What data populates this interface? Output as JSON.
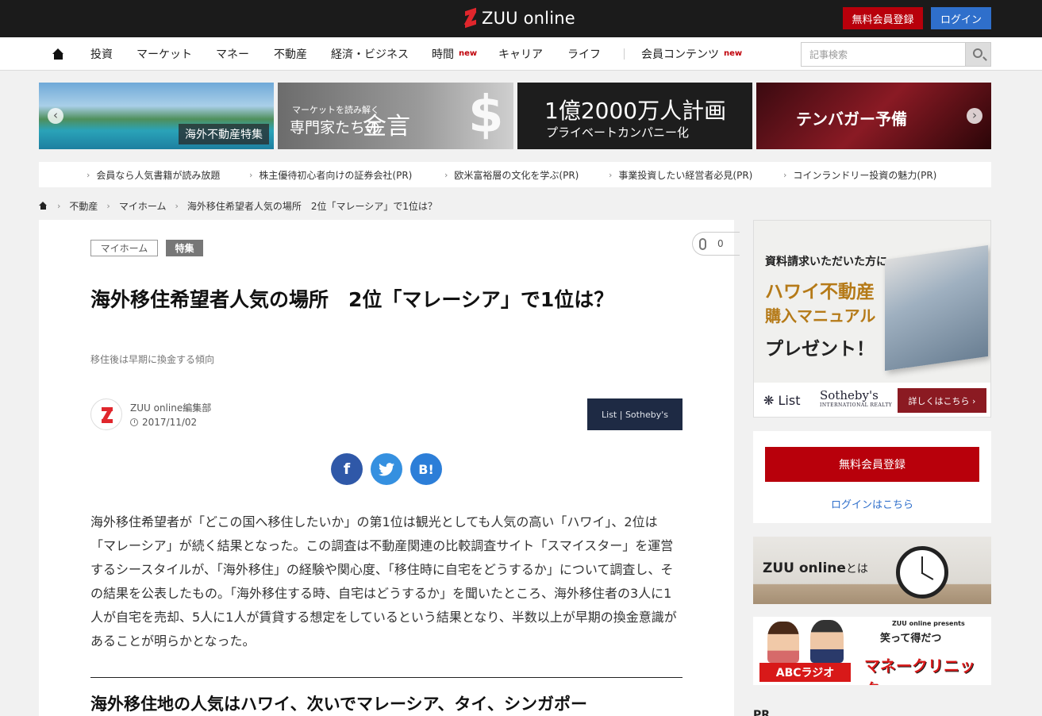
{
  "header": {
    "logo_text": "ZUU online",
    "register_label": "無料会員登録",
    "login_label": "ログイン"
  },
  "nav": {
    "items": [
      {
        "label": "投資"
      },
      {
        "label": "マーケット"
      },
      {
        "label": "マネー"
      },
      {
        "label": "不動産"
      },
      {
        "label": "経済・ビジネス"
      },
      {
        "label": "時間",
        "badge": "new"
      },
      {
        "label": "キャリア"
      },
      {
        "label": "ライフ"
      },
      {
        "label": "会員コンテンツ",
        "badge": "new"
      }
    ],
    "search_placeholder": "記事検索"
  },
  "banners": [
    {
      "text": "海外不動産特集"
    },
    {
      "text1": "マーケットを読み解く",
      "text2": "専門家たちの",
      "text3": "金言",
      "symbol": "$"
    },
    {
      "text1": "1億2000万人計画",
      "text2": "プライベートカンパニー化"
    },
    {
      "text": "テンバガー予備"
    }
  ],
  "banner_prev": "‹",
  "banner_next": "›",
  "pr_links": [
    "会員なら人気書籍が読み放題",
    "株主優待初心者向けの証券会社(PR)",
    "欧米富裕層の文化を学ぶ(PR)",
    "事業投資したい経営者必見(PR)",
    "コインランドリー投資の魅力(PR)"
  ],
  "breadcrumb": {
    "items": [
      "不動産",
      "マイホーム",
      "海外移住希望者人気の場所　2位「マレーシア」で1位は？"
    ]
  },
  "article": {
    "tags": [
      "マイホーム",
      "特集"
    ],
    "clip_count": "0",
    "title": "海外移住希望者人気の場所　2位「マレーシア」で1位は？",
    "subtitle": "移住後は早期に換金する傾向",
    "author": "ZUU online編集部",
    "date": "2017/11/02",
    "sponsor": "List | Sotheby's",
    "share_fb": "f",
    "share_hatena": "B!",
    "body": "海外移住希望者が「どこの国へ移住したいか」の第1位は観光としても人気の高い「ハワイ」、2位は「マレーシア」が続く結果となった。この調査は不動産関連の比較調査サイト「スマイスター」を運営するシースタイルが、「海外移住」の経験や関心度、「移住時に自宅をどうするか」について調査し、その結果を公表したもの。「海外移住する時、自宅はどうするか」を聞いたところ、海外移住者の3人に1人が自宅を売却、5人に1人が賃貸する想定をしているという結果となり、半数以上が早期の換金意識があることが明らかとなった。",
    "heading": "海外移住地の人気はハワイ、次いでマレーシア、タイ、シンガポー"
  },
  "sidebar": {
    "ad": {
      "line1": "資料請求いただいた方に",
      "line2": "ハワイ不動産",
      "line3": "購入マニュアル",
      "line4": "プレゼント！",
      "list_text": "List",
      "brand": "Sotheby's",
      "brand_sub": "INTERNATIONAL REALTY",
      "more_label": "詳しくはこちら ›"
    },
    "register_label": "無料会員登録",
    "login_link": "ログインはこちら",
    "about_text": "ZUU online",
    "about_suffix": "とは",
    "radio": {
      "abc_label": "ABCラジオ",
      "brand": "ZUU online presents",
      "sub": "笑って得だつ",
      "title": "マネークリニック"
    },
    "next_heading": "PR"
  }
}
